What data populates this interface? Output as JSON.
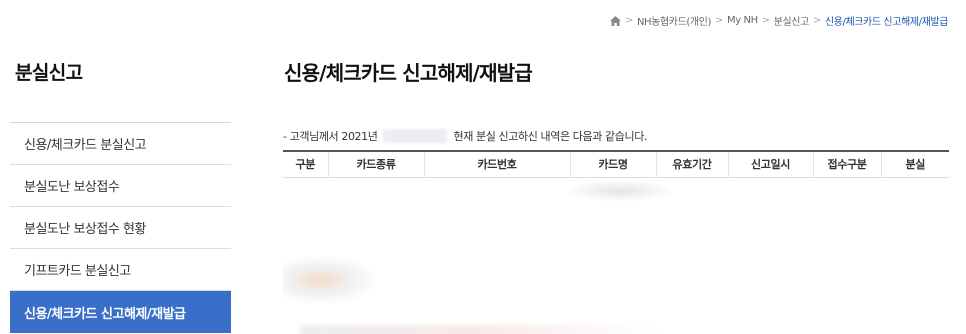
{
  "breadcrumb": {
    "items": [
      "NH농협카드(개인)",
      "My NH",
      "분실신고"
    ],
    "current": "신용/체크카드 신고해제/재발급"
  },
  "sidebar": {
    "title": "분실신고",
    "items": [
      {
        "label": "신용/체크카드 분실신고"
      },
      {
        "label": "분실도난 보상접수"
      },
      {
        "label": "분실도난 보상접수 현황"
      },
      {
        "label": "기프트카드 분실신고"
      },
      {
        "label": "신용/체크카드 신고해제/재발급"
      }
    ]
  },
  "main": {
    "title": "신용/체크카드 신고해제/재발급",
    "note_prefix": "- 고객님께서 2021년",
    "note_suffix": "현재 분실 신고하신 내역은 다음과 같습니다.",
    "columns": [
      "구분",
      "카드종류",
      "카드번호",
      "카드명",
      "유효기간",
      "신고일시",
      "접수구분",
      "분실"
    ]
  },
  "colors": {
    "accent": "#3a6fc9",
    "link": "#1a56b0"
  }
}
